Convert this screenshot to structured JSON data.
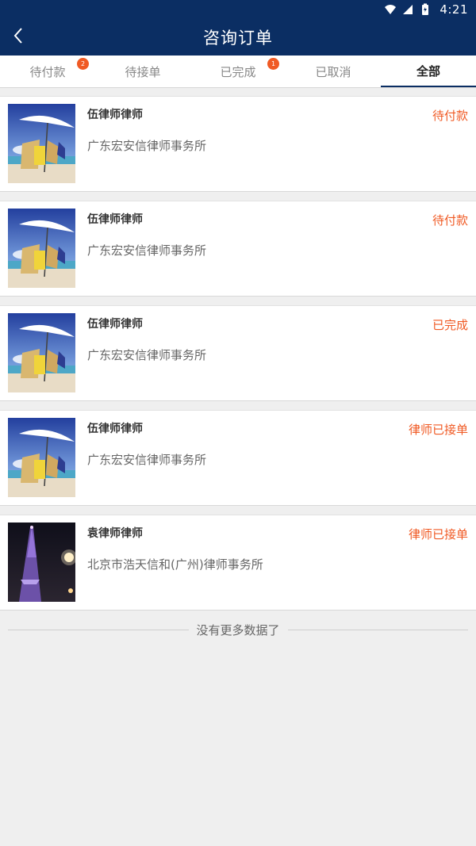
{
  "status_bar": {
    "time": "4:21",
    "icons": [
      "wifi-icon",
      "signal-icon",
      "battery-icon"
    ]
  },
  "header": {
    "title": "咨询订单",
    "back_icon": "back-arrow-icon"
  },
  "tabs": [
    {
      "label": "待付款",
      "badge": "2",
      "active": false
    },
    {
      "label": "待接单",
      "badge": "",
      "active": false
    },
    {
      "label": "已完成",
      "badge": "1",
      "active": false
    },
    {
      "label": "已取消",
      "badge": "",
      "active": false
    },
    {
      "label": "全部",
      "badge": "",
      "active": true
    }
  ],
  "orders": [
    {
      "name": "伍律师律师",
      "firm": "广东宏安信律师事务所",
      "status": "待付款",
      "image": "beach-image"
    },
    {
      "name": "伍律师律师",
      "firm": "广东宏安信律师事务所",
      "status": "待付款",
      "image": "beach-image"
    },
    {
      "name": "伍律师律师",
      "firm": "广东宏安信律师事务所",
      "status": "已完成",
      "image": "beach-image"
    },
    {
      "name": "伍律师律师",
      "firm": "广东宏安信律师事务所",
      "status": "律师已接单",
      "image": "beach-image"
    },
    {
      "name": "袁律师律师",
      "firm": "北京市浩天信和(广州)律师事务所",
      "status": "律师已接单",
      "image": "tower-image"
    }
  ],
  "footer": {
    "text": "没有更多数据了"
  },
  "colors": {
    "brand": "#0b2e63",
    "accent": "#f05a24",
    "background": "#efefef"
  }
}
